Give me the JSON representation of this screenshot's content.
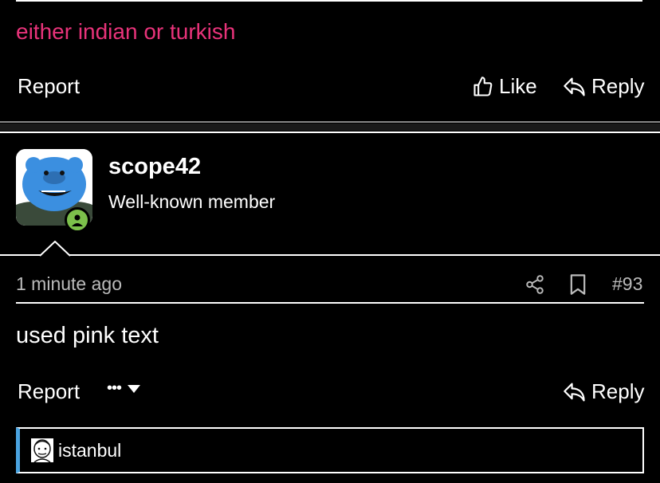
{
  "previous_post": {
    "message": "either indian or turkish",
    "report_label": "Report",
    "like_label": "Like",
    "reply_label": "Reply"
  },
  "post": {
    "author": {
      "username": "scope42",
      "title": "Well-known member",
      "online": true
    },
    "timestamp": "1 minute ago",
    "post_number": "#93",
    "message": "used pink text",
    "report_label": "Report",
    "more_label": "•••",
    "reply_label": "Reply"
  },
  "reaction_bar": {
    "label": "istanbul"
  },
  "colors": {
    "pink_text": "#e8337a",
    "online": "#7cc04b",
    "quote_accent": "#4aa3df",
    "avatar_face": "#3b8fe0"
  }
}
